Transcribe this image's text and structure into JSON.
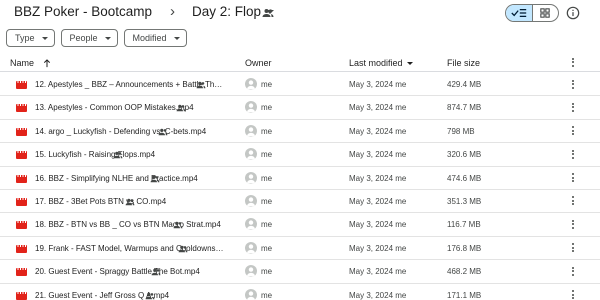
{
  "breadcrumb": {
    "root": "BBZ Poker - Bootcamp",
    "separator": "›",
    "current": "Day 2: Flop"
  },
  "filters": [
    {
      "label": "Type"
    },
    {
      "label": "People"
    },
    {
      "label": "Modified"
    }
  ],
  "columns": {
    "name": "Name",
    "owner": "Owner",
    "modified": "Last modified",
    "size": "File size"
  },
  "files": [
    {
      "name": "12. Apestyles _ BBZ – Announcements + Battle The Bot.m...",
      "shared": true,
      "owner": "me",
      "modified": "May 3, 2024 me",
      "size": "429.4 MB"
    },
    {
      "name": "13. Apestyles - Common OOP Mistakes.mp4",
      "shared": true,
      "owner": "me",
      "modified": "May 3, 2024 me",
      "size": "874.7 MB"
    },
    {
      "name": "14. argo _ Luckyfish - Defending vs. C-bets.mp4",
      "shared": true,
      "owner": "me",
      "modified": "May 3, 2024 me",
      "size": "798 MB"
    },
    {
      "name": "15. Luckyfish - Raising Flops.mp4",
      "shared": true,
      "owner": "me",
      "modified": "May 3, 2024 me",
      "size": "320.6 MB"
    },
    {
      "name": "16. BBZ - Simplifying NLHE and Practice.mp4",
      "shared": true,
      "owner": "me",
      "modified": "May 3, 2024 me",
      "size": "474.6 MB"
    },
    {
      "name": "17. BBZ - 3Bet Pots BTN vs CO.mp4",
      "shared": true,
      "owner": "me",
      "modified": "May 3, 2024 me",
      "size": "351.3 MB"
    },
    {
      "name": "18. BBZ - BTN vs BB _ CO vs BTN Macro Strat.mp4",
      "shared": true,
      "owner": "me",
      "modified": "May 3, 2024 me",
      "size": "116.7 MB"
    },
    {
      "name": "19. Frank - FAST Model, Warmups and Cooldowns.mp4",
      "shared": true,
      "owner": "me",
      "modified": "May 3, 2024 me",
      "size": "176.8 MB"
    },
    {
      "name": "20. Guest Event - Spraggy Battle The Bot.mp4",
      "shared": true,
      "owner": "me",
      "modified": "May 3, 2024 me",
      "size": "468.2 MB"
    },
    {
      "name": "21. Guest Event - Jeff Gross Q A.mp4",
      "shared": true,
      "owner": "me",
      "modified": "May 3, 2024 me",
      "size": "171.1 MB"
    }
  ],
  "icons": {
    "file": "video-file-icon",
    "shared": "people-icon",
    "view_list": "check-list-icon",
    "view_grid": "grid-icon",
    "info": "info-icon",
    "more": "more-vert-icon"
  },
  "colors": {
    "video_icon": "#e2231a",
    "toggle_active": "#c2e7ff"
  }
}
